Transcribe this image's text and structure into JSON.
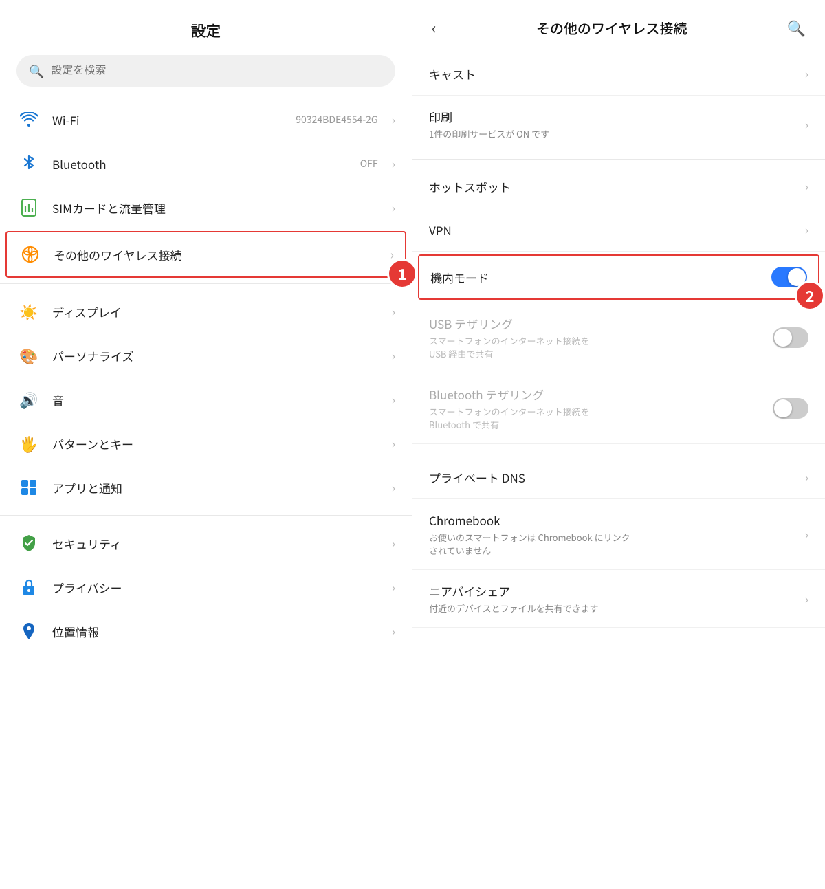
{
  "left": {
    "title": "設定",
    "search_placeholder": "設定を検索",
    "items": [
      {
        "id": "wifi",
        "label": "Wi-Fi",
        "sub": "90324BDE4554-2G",
        "icon": "wifi",
        "has_chevron": true
      },
      {
        "id": "bluetooth",
        "label": "Bluetooth",
        "right_info": "OFF",
        "icon": "bluetooth",
        "has_chevron": true
      },
      {
        "id": "sim",
        "label": "SIMカードと流量管理",
        "icon": "sim",
        "has_chevron": true
      },
      {
        "id": "wireless",
        "label": "その他のワイヤレス接続",
        "icon": "wireless",
        "has_chevron": true,
        "highlighted": true
      }
    ],
    "items2": [
      {
        "id": "display",
        "label": "ディスプレイ",
        "icon": "display",
        "has_chevron": true
      },
      {
        "id": "personalize",
        "label": "パーソナライズ",
        "icon": "personalize",
        "has_chevron": true
      },
      {
        "id": "sound",
        "label": "音",
        "icon": "sound",
        "has_chevron": true
      },
      {
        "id": "pattern",
        "label": "パターンとキー",
        "icon": "pattern",
        "has_chevron": true
      },
      {
        "id": "apps",
        "label": "アプリと通知",
        "icon": "apps",
        "has_chevron": true
      }
    ],
    "items3": [
      {
        "id": "security",
        "label": "セキュリティ",
        "icon": "security",
        "has_chevron": true
      },
      {
        "id": "privacy",
        "label": "プライバシー",
        "icon": "privacy",
        "has_chevron": true
      },
      {
        "id": "location",
        "label": "位置情報",
        "icon": "location",
        "has_chevron": true
      }
    ]
  },
  "right": {
    "title": "その他のワイヤレス接続",
    "items": [
      {
        "id": "cast",
        "label": "キャスト",
        "sub": null,
        "has_chevron": true
      },
      {
        "id": "print",
        "label": "印刷",
        "sub": "1件の印刷サービスが ON です",
        "has_chevron": true
      },
      {
        "id": "hotspot",
        "label": "ホットスポット",
        "sub": null,
        "has_chevron": true
      },
      {
        "id": "vpn",
        "label": "VPN",
        "sub": null,
        "has_chevron": true
      },
      {
        "id": "airplane",
        "label": "機内モード",
        "sub": null,
        "has_toggle": true,
        "toggle_on": true,
        "highlighted": true
      },
      {
        "id": "usb_tether",
        "label": "USB テザリング",
        "sub": "スマートフォンのインターネット接続を\nUSB 経由で共有",
        "has_toggle": true,
        "toggle_on": false,
        "disabled": true
      },
      {
        "id": "bt_tether",
        "label": "Bluetooth テザリング",
        "sub": "スマートフォンのインターネット接続を\nBluetooth で共有",
        "has_toggle": true,
        "toggle_on": false,
        "disabled": true
      },
      {
        "id": "private_dns",
        "label": "プライベート DNS",
        "sub": null,
        "has_chevron": true
      },
      {
        "id": "chromebook",
        "label": "Chromebook",
        "sub": "お使いのスマートフォンは Chromebook にリンク\nされていません",
        "has_chevron": true
      },
      {
        "id": "nearby_share",
        "label": "ニアバイシェア",
        "sub": "付近のデバイスとファイルを共有できます",
        "has_chevron": true
      }
    ]
  },
  "annotation1": "1",
  "annotation2": "2"
}
